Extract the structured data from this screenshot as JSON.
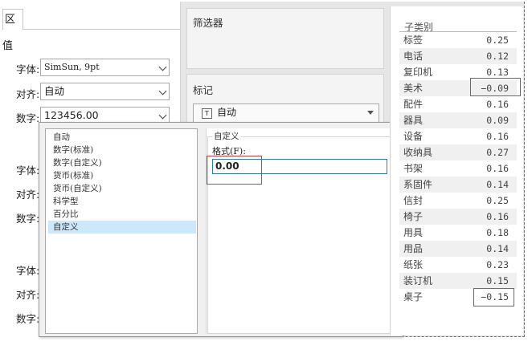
{
  "left": {
    "tab_label": "区",
    "section_title": "值",
    "font_label": "字体:",
    "font_value": "SimSun, 9pt",
    "align_label": "对齐:",
    "align_value": "自动",
    "number_label": "数字:",
    "number_value": "123456.00",
    "repeat": [
      {
        "font": "字体:",
        "align": "对齐:",
        "number": "数字:"
      },
      {
        "font": "字体:",
        "align": "对齐:",
        "number": "数字:"
      }
    ]
  },
  "middle": {
    "filter_title": "筛选器",
    "marks_title": "标记",
    "marks_value": "自动",
    "marks_icon": "T"
  },
  "popup": {
    "categories": [
      "自动",
      "数字(标准)",
      "数字(自定义)",
      "货币(标准)",
      "货币(自定义)",
      "科学型",
      "百分比",
      "自定义"
    ],
    "selected_index": 7,
    "group_title": "自定义",
    "format_label": "格式(F):",
    "format_value": "0.00"
  },
  "table": {
    "header": "子类别",
    "rows": [
      {
        "label": "标签",
        "value": "0.25"
      },
      {
        "label": "电话",
        "value": "0.12"
      },
      {
        "label": "复印机",
        "value": "0.13"
      },
      {
        "label": "美术",
        "value": "−0.09"
      },
      {
        "label": "配件",
        "value": "0.16"
      },
      {
        "label": "器具",
        "value": "0.09"
      },
      {
        "label": "设备",
        "value": "0.16"
      },
      {
        "label": "收纳具",
        "value": "0.27"
      },
      {
        "label": "书架",
        "value": "0.16"
      },
      {
        "label": "系固件",
        "value": "0.14"
      },
      {
        "label": "信封",
        "value": "0.25"
      },
      {
        "label": "椅子",
        "value": "0.16"
      },
      {
        "label": "用具",
        "value": "0.18"
      },
      {
        "label": "用品",
        "value": "0.14"
      },
      {
        "label": "纸张",
        "value": "0.23"
      },
      {
        "label": "装订机",
        "value": "0.15"
      },
      {
        "label": "桌子",
        "value": "−0.15"
      }
    ]
  },
  "colors": {
    "highlight": "#d93a3a",
    "selection": "#cde8fb",
    "focus_border": "#2b78c5"
  }
}
